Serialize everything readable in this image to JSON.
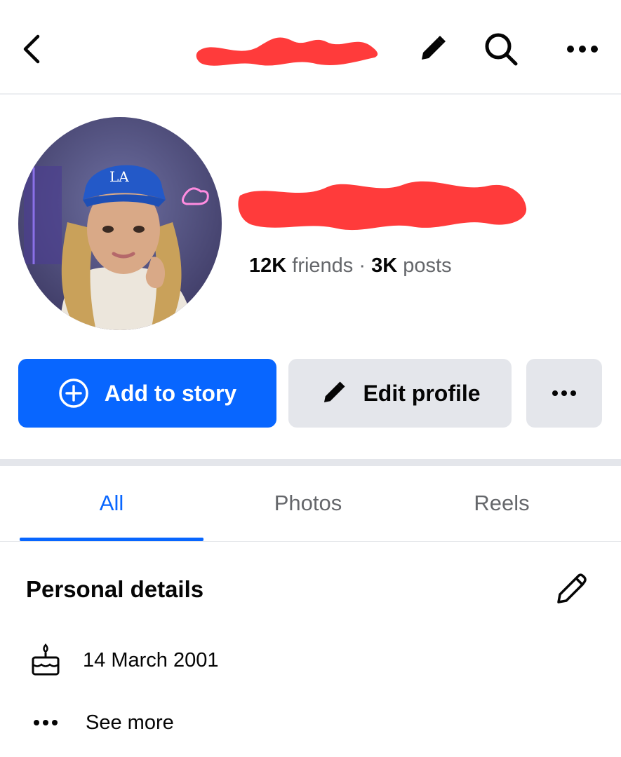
{
  "topbar": {
    "back_icon": "chevron-left-icon",
    "edit_icon": "pencil-icon",
    "search_icon": "search-icon",
    "more_icon": "more-horizontal-icon",
    "redaction_color": "#ff3b3b"
  },
  "profile": {
    "friends_count": "12K",
    "friends_label": "friends",
    "separator": "·",
    "posts_count": "3K",
    "posts_label": "posts"
  },
  "actions": {
    "add_story_label": "Add to story",
    "edit_profile_label": "Edit profile",
    "more_icon": "more-horizontal-icon",
    "accent_color": "#0866ff"
  },
  "tabs": [
    {
      "label": "All",
      "active": true
    },
    {
      "label": "Photos",
      "active": false
    },
    {
      "label": "Reels",
      "active": false
    }
  ],
  "personal_details": {
    "title": "Personal details",
    "birthday": "14 March 2001",
    "see_more": "See more"
  }
}
